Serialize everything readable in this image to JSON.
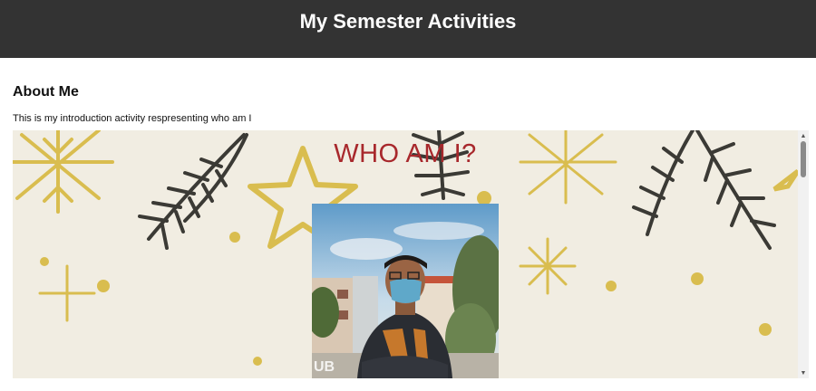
{
  "header": {
    "title": "My Semester Activities"
  },
  "section": {
    "title": "About Me",
    "description": "This is my introduction activity respresenting who am I"
  },
  "embed": {
    "heading": "WHO AM I?",
    "heading_color": "#a8282c",
    "background_color": "#f1ede2",
    "accent_gold": "#d9bd4f",
    "branch_color": "#3b3a35",
    "photo_overlay_text": "UB",
    "scroll_position": 0.0
  }
}
